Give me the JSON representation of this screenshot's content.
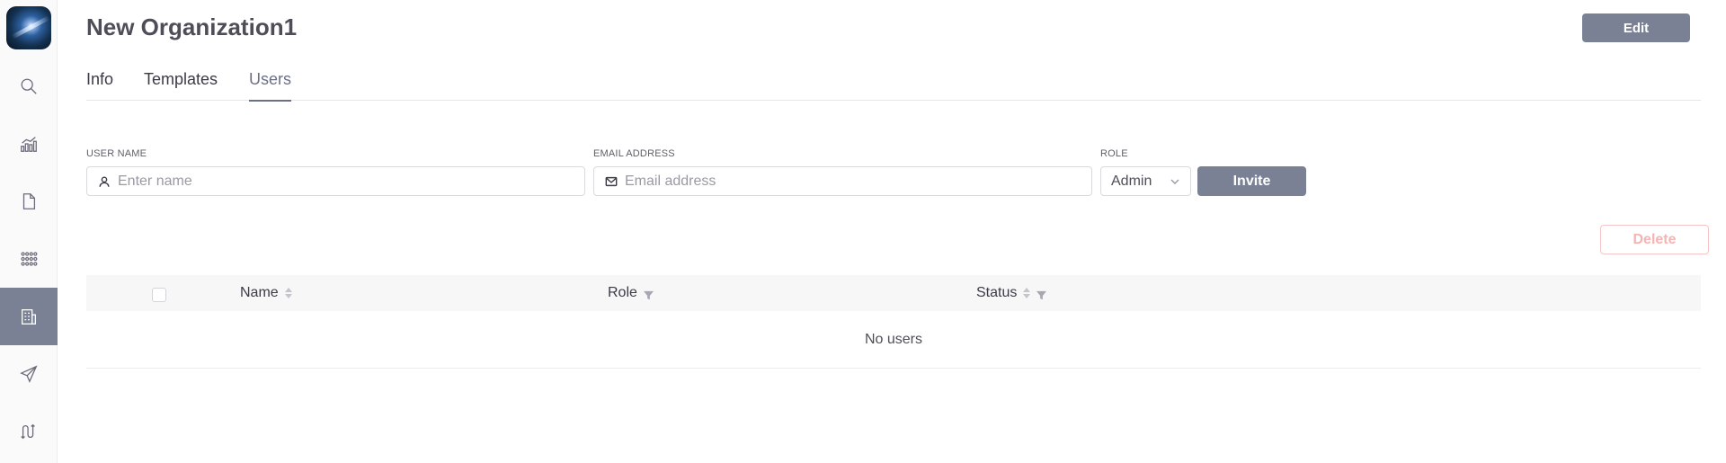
{
  "sidebar": {
    "items": [
      {
        "icon": "search-icon"
      },
      {
        "icon": "analytics-icon"
      },
      {
        "icon": "document-icon"
      },
      {
        "icon": "apps-grid-icon"
      },
      {
        "icon": "building-icon",
        "active": true
      },
      {
        "icon": "send-icon"
      },
      {
        "icon": "flow-icon"
      }
    ]
  },
  "header": {
    "title": "New Organization1",
    "edit_label": "Edit"
  },
  "tabs": [
    {
      "label": "Info"
    },
    {
      "label": "Templates"
    },
    {
      "label": "Users",
      "active": true
    }
  ],
  "invite_form": {
    "user_name": {
      "label": "USER NAME",
      "placeholder": "Enter name",
      "value": ""
    },
    "email": {
      "label": "EMAIL ADDRESS",
      "placeholder": "Email address",
      "value": ""
    },
    "role": {
      "label": "ROLE",
      "value": "Admin"
    },
    "invite_label": "Invite"
  },
  "table": {
    "delete_label": "Delete",
    "columns": [
      "Name",
      "Role",
      "Status"
    ],
    "empty_text": "No users"
  },
  "colors": {
    "accent": "#7b8195",
    "delete_disabled": "#f4b4b4"
  }
}
